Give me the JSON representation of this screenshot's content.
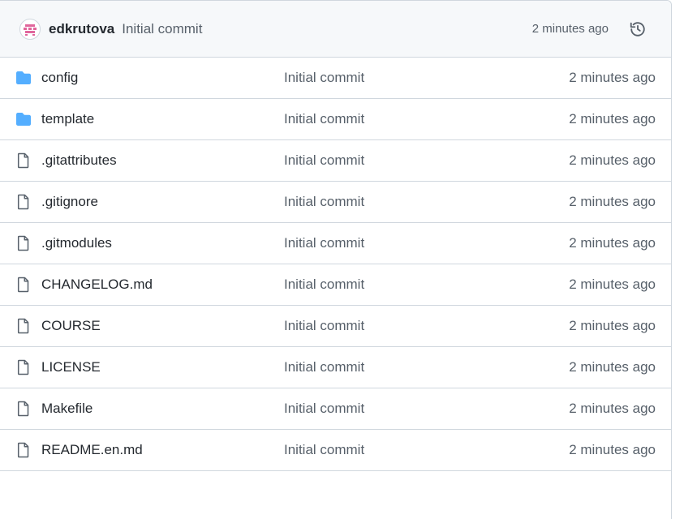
{
  "latest_commit": {
    "author": "edkrutova",
    "message": "Initial commit",
    "time": "2 minutes ago",
    "avatar_color": "#e0669c",
    "history_icon": "history-icon"
  },
  "colors": {
    "folder": "#54aeff",
    "file": "#57606a"
  },
  "files": [
    {
      "type": "folder",
      "name": "config",
      "commit": "Initial commit",
      "time": "2 minutes ago"
    },
    {
      "type": "folder",
      "name": "template",
      "commit": "Initial commit",
      "time": "2 minutes ago"
    },
    {
      "type": "file",
      "name": ".gitattributes",
      "commit": "Initial commit",
      "time": "2 minutes ago"
    },
    {
      "type": "file",
      "name": ".gitignore",
      "commit": "Initial commit",
      "time": "2 minutes ago"
    },
    {
      "type": "file",
      "name": ".gitmodules",
      "commit": "Initial commit",
      "time": "2 minutes ago"
    },
    {
      "type": "file",
      "name": "CHANGELOG.md",
      "commit": "Initial commit",
      "time": "2 minutes ago"
    },
    {
      "type": "file",
      "name": "COURSE",
      "commit": "Initial commit",
      "time": "2 minutes ago"
    },
    {
      "type": "file",
      "name": "LICENSE",
      "commit": "Initial commit",
      "time": "2 minutes ago"
    },
    {
      "type": "file",
      "name": "Makefile",
      "commit": "Initial commit",
      "time": "2 minutes ago"
    },
    {
      "type": "file",
      "name": "README.en.md",
      "commit": "Initial commit",
      "time": "2 minutes ago"
    }
  ]
}
